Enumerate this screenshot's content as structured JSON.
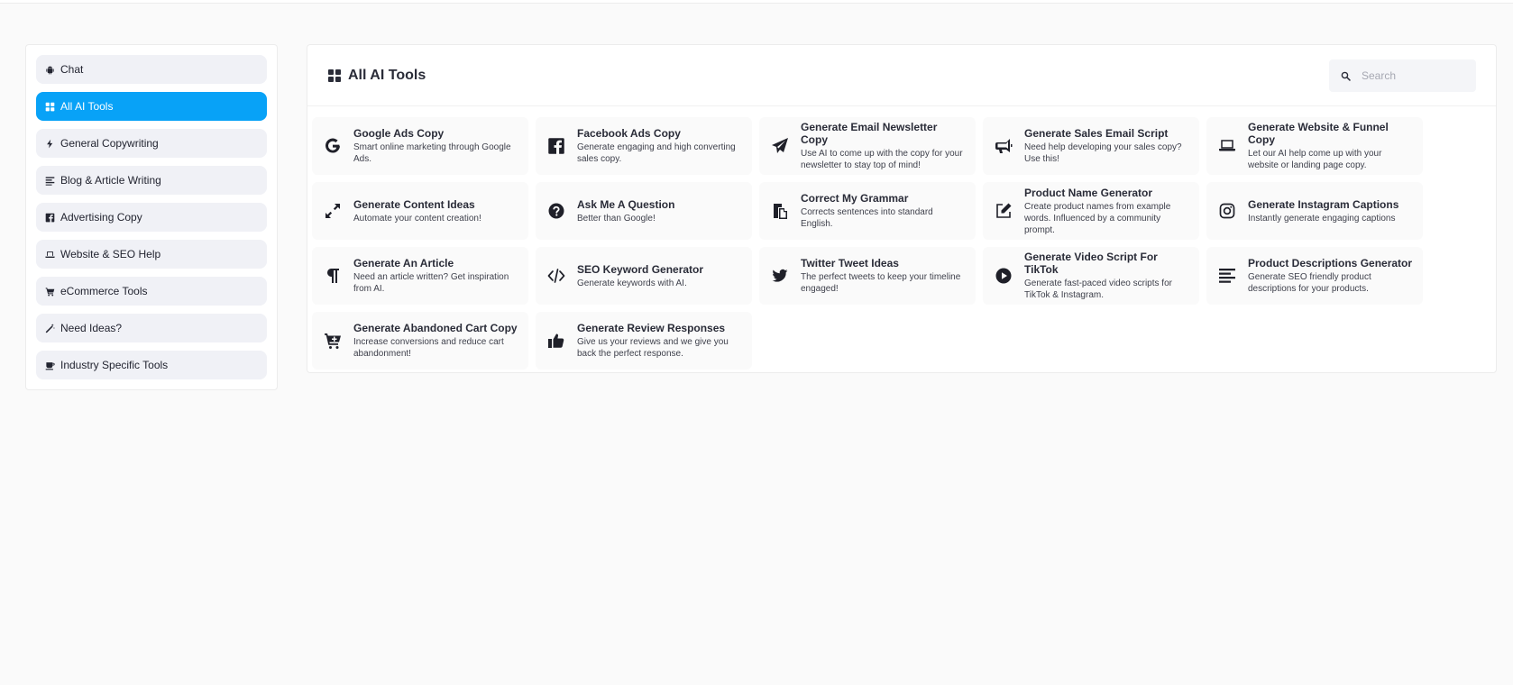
{
  "sidebar": {
    "items": [
      {
        "label": "Chat",
        "icon": "android-icon",
        "active": false
      },
      {
        "label": "All AI Tools",
        "icon": "grid-icon",
        "active": true
      },
      {
        "label": "General Copywriting",
        "icon": "bolt-icon",
        "active": false
      },
      {
        "label": "Blog & Article Writing",
        "icon": "align-left-icon",
        "active": false
      },
      {
        "label": "Advertising Copy",
        "icon": "facebook-square-icon",
        "active": false
      },
      {
        "label": "Website & SEO Help",
        "icon": "laptop-icon",
        "active": false
      },
      {
        "label": "eCommerce Tools",
        "icon": "cart-icon",
        "active": false
      },
      {
        "label": "Need Ideas?",
        "icon": "magic-wand-icon",
        "active": false
      },
      {
        "label": "Industry Specific Tools",
        "icon": "mug-icon",
        "active": false
      }
    ]
  },
  "main": {
    "title": "All AI Tools",
    "title_icon": "grid-icon",
    "search": {
      "placeholder": "Search",
      "icon": "search-icon"
    }
  },
  "tools": [
    {
      "title": "Google Ads Copy",
      "desc": "Smart online marketing through Google Ads.",
      "icon": "google-icon"
    },
    {
      "title": "Facebook Ads Copy",
      "desc": "Generate engaging and high converting sales copy.",
      "icon": "facebook-icon"
    },
    {
      "title": "Generate Email Newsletter Copy",
      "desc": "Use AI to come up with the copy for your newsletter to stay top of mind!",
      "icon": "paper-plane-icon"
    },
    {
      "title": "Generate Sales Email Script",
      "desc": "Need help developing your sales copy? Use this!",
      "icon": "megaphone-icon"
    },
    {
      "title": "Generate Website & Funnel Copy",
      "desc": "Let our AI help come up with your website or landing page copy.",
      "icon": "laptop-icon"
    },
    {
      "title": "Generate Content Ideas",
      "desc": "Automate your content creation!",
      "icon": "expand-icon"
    },
    {
      "title": "Ask Me A Question",
      "desc": "Better than Google!",
      "icon": "question-circle-icon"
    },
    {
      "title": "Correct My Grammar",
      "desc": "Corrects sentences into standard English.",
      "icon": "paste-icon"
    },
    {
      "title": "Product Name Generator",
      "desc": "Create product names from example words. Influenced by a community prompt.",
      "icon": "edit-icon"
    },
    {
      "title": "Generate Instagram Captions",
      "desc": "Instantly generate engaging captions",
      "icon": "instagram-icon"
    },
    {
      "title": "Generate An Article",
      "desc": "Need an article written? Get inspiration from AI.",
      "icon": "paragraph-icon"
    },
    {
      "title": "SEO Keyword Generator",
      "desc": "Generate keywords with AI.",
      "icon": "code-icon"
    },
    {
      "title": "Twitter Tweet Ideas",
      "desc": "The perfect tweets to keep your timeline engaged!",
      "icon": "twitter-icon"
    },
    {
      "title": "Generate Video Script For TikTok",
      "desc": "Generate fast-paced video scripts for TikTok & Instagram.",
      "icon": "play-circle-icon"
    },
    {
      "title": "Product Descriptions Generator",
      "desc": "Generate SEO friendly product descriptions for your products.",
      "icon": "align-left-icon"
    },
    {
      "title": "Generate Abandoned Cart Copy",
      "desc": "Increase conversions and reduce cart abandonment!",
      "icon": "cart-plus-icon"
    },
    {
      "title": "Generate Review Responses",
      "desc": "Give us your reviews and we give you back the perfect response.",
      "icon": "thumbs-up-icon"
    }
  ],
  "colors": {
    "accent": "#08a2f7",
    "background": "#fafafa",
    "sidebar_item_bg": "#f0f1f6",
    "text": "#2a2c38"
  }
}
